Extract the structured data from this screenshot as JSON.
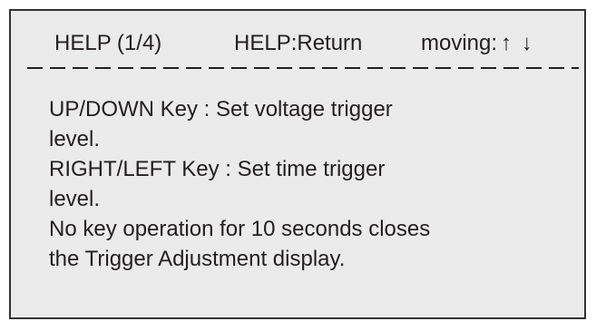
{
  "header": {
    "title": "HELP (1/4)",
    "hint": "HELP:Return",
    "moving_label": "moving:",
    "up_arrow": "↑",
    "down_arrow": "↓"
  },
  "help_lines": [
    "UP/DOWN Key : Set voltage trigger",
    "level.",
    "RIGHT/LEFT Key : Set time trigger",
    "level.",
    "No key operation for 10 seconds closes",
    "the Trigger Adjustment display."
  ]
}
